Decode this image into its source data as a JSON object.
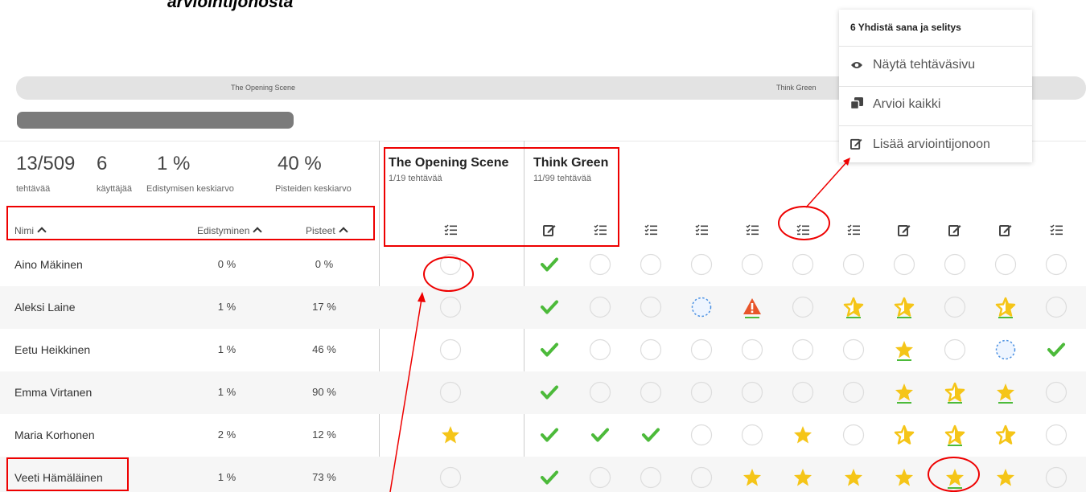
{
  "page": {
    "title_fragment": "arviointijonosta"
  },
  "course_bar": {
    "left_label": "The Opening Scene",
    "right_label": "Think Green"
  },
  "stats": {
    "tasks_value": "13/509",
    "tasks_label": "tehtävää",
    "users_value": "6",
    "users_label": "käyttäjää",
    "progress_value": "1 %",
    "progress_label": "Edistymisen keskiarvo",
    "points_value": "40 %",
    "points_label": "Pisteiden keskiarvo"
  },
  "headers": {
    "name": "Nimi",
    "progress": "Edistyminen",
    "points": "Pisteet"
  },
  "courses": [
    {
      "title": "The Opening Scene",
      "subtitle": "1/19 tehtävää"
    },
    {
      "title": "Think Green",
      "subtitle": "11/99 tehtävää"
    }
  ],
  "column_icons": [
    "checklist-icon",
    "edit-icon",
    "checklist-icon",
    "checklist-icon",
    "checklist-icon",
    "checklist-icon",
    "checklist-icon",
    "checklist-icon",
    "edit-icon",
    "edit-icon",
    "edit-icon",
    "checklist-icon"
  ],
  "students": [
    {
      "name": "Aino Mäkinen",
      "progress": "0 %",
      "points": "0 %",
      "marks": [
        "empty",
        "check",
        "empty",
        "empty",
        "empty",
        "empty",
        "empty",
        "empty",
        "empty",
        "empty",
        "empty",
        "empty",
        "empty"
      ]
    },
    {
      "name": "Aleksi Laine",
      "progress": "1 %",
      "points": "17 %",
      "marks": [
        "empty",
        "check",
        "empty",
        "empty",
        "dashed",
        "warning",
        "empty",
        "star-outline-ul",
        "star-outline-ul",
        "empty",
        "star-outline-ul",
        "empty",
        "empty"
      ]
    },
    {
      "name": "Eetu Heikkinen",
      "progress": "1 %",
      "points": "46 %",
      "marks": [
        "empty",
        "check",
        "empty",
        "empty",
        "empty",
        "empty",
        "empty",
        "empty",
        "star-ul",
        "empty",
        "dashed",
        "check",
        "empty"
      ]
    },
    {
      "name": "Emma Virtanen",
      "progress": "1 %",
      "points": "90 %",
      "marks": [
        "empty",
        "check",
        "empty",
        "empty",
        "empty",
        "empty",
        "empty",
        "empty",
        "star-ul",
        "star-outline-ul",
        "star-ul",
        "empty",
        "empty"
      ]
    },
    {
      "name": "Maria Korhonen",
      "progress": "2 %",
      "points": "12 %",
      "marks": [
        "star",
        "check",
        "check",
        "check",
        "empty",
        "empty",
        "star",
        "empty",
        "star-outline",
        "star-outline-ul",
        "star-outline",
        "empty",
        "empty"
      ]
    },
    {
      "name": "Veeti Hämäläinen",
      "progress": "1 %",
      "points": "73 %",
      "marks": [
        "empty",
        "check",
        "empty",
        "empty",
        "empty",
        "star",
        "star",
        "star",
        "star",
        "star-ul",
        "star",
        "empty",
        "empty"
      ]
    }
  ],
  "dropdown": {
    "title": "6 Yhdistä sana ja selitys",
    "items": [
      {
        "icon": "eye-icon",
        "label": "Näytä tehtäväsivu"
      },
      {
        "icon": "copy-icon",
        "label": "Arvioi kaikki"
      },
      {
        "icon": "edit-icon",
        "label": "Lisää arviointijonoon"
      }
    ]
  },
  "colors": {
    "check": "#4cba3a",
    "star": "#f5c518",
    "warning": "#e8552a",
    "annotation": "#e00000",
    "dashed": "#4a90e2"
  }
}
